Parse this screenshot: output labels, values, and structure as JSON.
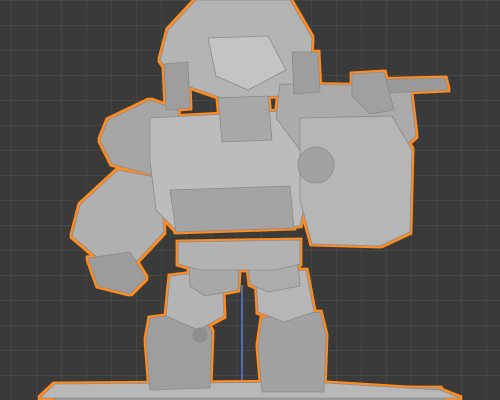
{
  "viewport": {
    "background_color": "#3a3a3a",
    "grid_color": "#454545",
    "z_axis_color": "#5b7fd6",
    "selection_outline_color": "#ff8c1a",
    "model_base_color": "#a9a9a9",
    "object": "mech-robot-model",
    "selected": true
  }
}
